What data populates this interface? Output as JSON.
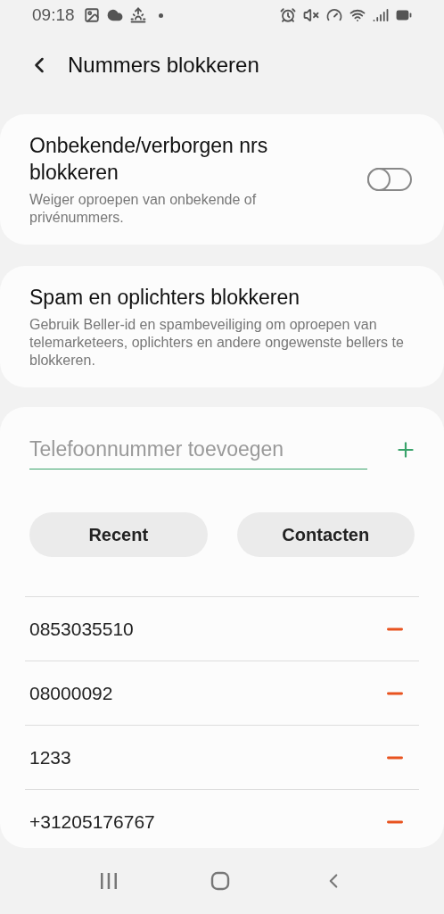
{
  "status_bar": {
    "time": "09:18"
  },
  "header": {
    "title": "Nummers blokkeren"
  },
  "settings": [
    {
      "kind": "toggle",
      "title": "Onbekende/verborgen nrs blokkeren",
      "description": "Weiger oproepen van onbekende of privénummers.",
      "on": false
    },
    {
      "kind": "link",
      "title": "Spam en oplichters blokkeren",
      "description": "Gebruik Beller-id en spambeveiliging om oproepen van telemarketeers, oplichters en andere ongewenste bellers te blokkeren."
    }
  ],
  "add_number": {
    "placeholder": "Telefoonnummer toevoegen"
  },
  "buttons": [
    "Recent",
    "Contacten"
  ],
  "blocked_numbers": [
    "0853035510",
    "08000092",
    "1233",
    "+31205176767"
  ]
}
